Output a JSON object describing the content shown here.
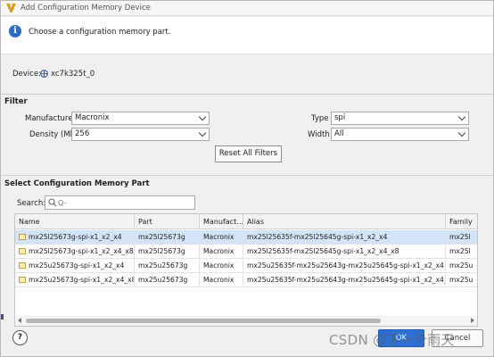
{
  "window": {
    "title": "Add Configuration Memory Device"
  },
  "banner": {
    "message": "Choose a configuration memory part."
  },
  "device": {
    "label": "Device:",
    "value": "xc7k325t_0"
  },
  "filter": {
    "section_title": "Filter",
    "manufacturer_label": "Manufacturer",
    "manufacturer_value": "Macronix",
    "density_label": "Density (Mb)",
    "density_value": "256",
    "type_label": "Type",
    "type_value": "spi",
    "width_label": "Width",
    "width_value": "All",
    "reset_label": "Reset All Filters"
  },
  "select": {
    "section_title": "Select Configuration Memory Part",
    "search_label": "Search:",
    "search_placeholder": "Q-"
  },
  "table": {
    "columns": [
      "Name",
      "Part",
      "Manufact...",
      "Alias",
      "Family"
    ],
    "rows": [
      [
        "mx25l25673g-spi-x1_x2_x4",
        "mx25l25673g",
        "Macronix",
        "mx25l25635f-mx25l25645g-spi-x1_x2_x4",
        "mx25l"
      ],
      [
        "mx25l25673g-spi-x1_x2_x4_x8",
        "mx25l25673g",
        "Macronix",
        "mx25l25635f-mx25l25645g-spi-x1_x2_x4_x8",
        "mx25l"
      ],
      [
        "mx25u25673g-spi-x1_x2_x4",
        "mx25u25673g",
        "Macronix",
        "mx25u25635f-mx25u25643g-mx25u25645g-spi-x1_x2_x4",
        "mx25u"
      ],
      [
        "mx25u25673g-spi-x1_x2_x4_x8",
        "mx25u25673g",
        "Macronix",
        "mx25u25635f-mx25u25643g-mx25u25645g-spi-x1_x2_x4_x8",
        "mx25u"
      ]
    ],
    "selected_row": 0
  },
  "footer": {
    "help_label": "?",
    "ok_label": "OK",
    "cancel_label": "Cancel",
    "watermark": "CSDN @下一个雨天"
  },
  "colors": {
    "accent": "#2f6fd0",
    "selection": "#d3e3f8",
    "info": "#2d6cc6"
  },
  "icons": [
    "vivado-logo-icon",
    "info-icon",
    "chip-icon",
    "search-icon",
    "memory-part-icon",
    "help-icon"
  ]
}
